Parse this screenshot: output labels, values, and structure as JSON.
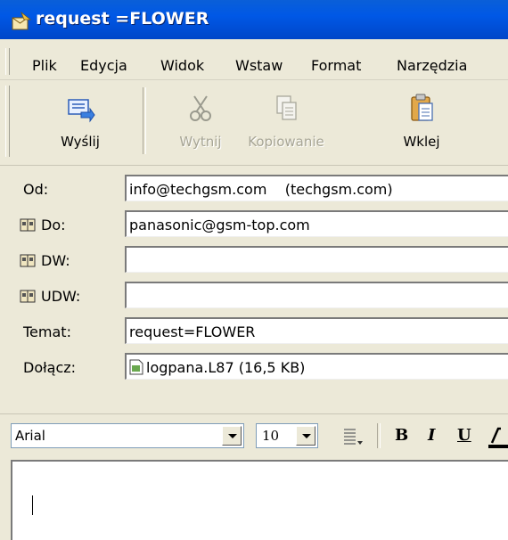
{
  "window": {
    "title": "request =FLOWER"
  },
  "menu": [
    "Plik",
    "Edycja",
    "Widok",
    "Wstaw",
    "Format",
    "Narzędzia"
  ],
  "toolbar": {
    "send": "Wyślij",
    "cut": "Wytnij",
    "copy": "Kopiowanie",
    "paste": "Wklej"
  },
  "headers": {
    "from": {
      "label": "Od:",
      "value": "info@techgsm.com    (techgsm.com)"
    },
    "to": {
      "label": "Do:",
      "value": "panasonic@gsm-top.com"
    },
    "cc": {
      "label": "DW:",
      "value": ""
    },
    "bcc": {
      "label": "UDW:",
      "value": ""
    },
    "subject": {
      "label": "Temat:",
      "value": "request=FLOWER"
    },
    "attach": {
      "label": "Dołącz:",
      "value": "logpana.L87 (16,5 KB)"
    }
  },
  "format": {
    "font": "Arial",
    "size": "10",
    "bold": "B",
    "italic": "I",
    "underline": "U"
  },
  "icons": {
    "title": "outlook-compose-icon",
    "send": "send-icon",
    "cut": "scissors-icon",
    "copy": "copy-icon",
    "paste": "clipboard-icon",
    "address_book": "address-book-icon",
    "attachment": "attachment-file-icon",
    "bullets": "bullet-list-icon"
  },
  "colors": {
    "titlebar": "#0054e3",
    "face": "#ece9d8",
    "disabled_text": "#a7a595"
  }
}
